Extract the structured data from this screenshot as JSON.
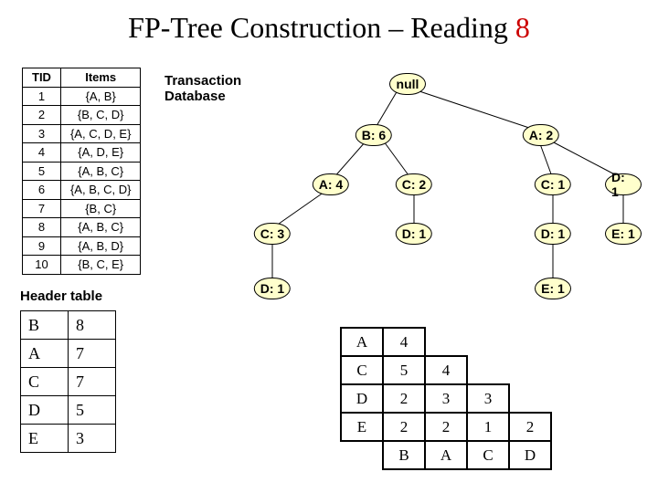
{
  "title_prefix": "FP-Tree Construction – Reading ",
  "title_num": "8",
  "labels": {
    "txn_db": "Transaction Database",
    "header_table": "Header table"
  },
  "txn_header": [
    "TID",
    "Items"
  ],
  "txn_rows": [
    [
      "1",
      "{A, B}"
    ],
    [
      "2",
      "{B, C, D}"
    ],
    [
      "3",
      "{A, C, D, E}"
    ],
    [
      "4",
      "{A, D, E}"
    ],
    [
      "5",
      "{A, B, C}"
    ],
    [
      "6",
      "{A, B, C, D}"
    ],
    [
      "7",
      "{B, C}"
    ],
    [
      "8",
      "{A, B, C}"
    ],
    [
      "9",
      "{A, B, D}"
    ],
    [
      "10",
      "{B, C, E}"
    ]
  ],
  "header_table": [
    [
      "B",
      "8"
    ],
    [
      "A",
      "7"
    ],
    [
      "C",
      "7"
    ],
    [
      "D",
      "5"
    ],
    [
      "E",
      "3"
    ]
  ],
  "cond_matrix": {
    "row_labels": [
      "A",
      "C",
      "D",
      "E",
      ""
    ],
    "grid": [
      [
        "4",
        "",
        "",
        ""
      ],
      [
        "5",
        "4",
        "",
        ""
      ],
      [
        "2",
        "3",
        "3",
        ""
      ],
      [
        "2",
        "2",
        "1",
        "2"
      ],
      [
        "B",
        "A",
        "C",
        "D"
      ]
    ]
  },
  "tree": {
    "nodes": {
      "null": "null",
      "b6": "B: 6",
      "a2": "A: 2",
      "a4": "A: 4",
      "c2": "C: 2",
      "c1": "C: 1",
      "d1a": "D: 1",
      "c3": "C: 3",
      "d1b": "D: 1",
      "d1c": "D: 1",
      "e1a": "E: 1",
      "d1d": "D: 1",
      "e1b": "E: 1"
    }
  }
}
